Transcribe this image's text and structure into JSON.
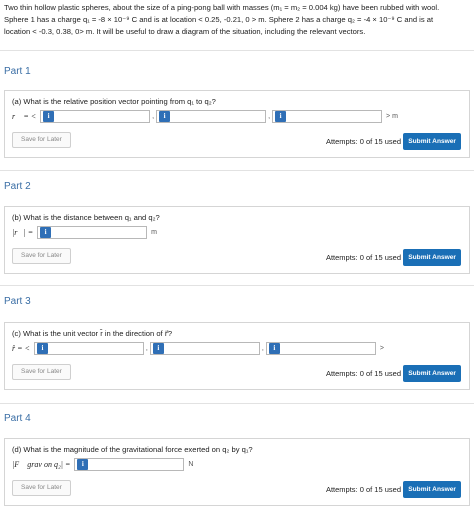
{
  "problem": {
    "line1": "Two thin hollow plastic spheres, about the size of a ping-pong ball with masses (m₁ = m₂ = 0.004 kg) have been rubbed with wool.",
    "line2": "Sphere 1 has a charge q₁ = -8 × 10⁻⁹ C and is at location < 0.25, -0.21, 0 > m. Sphere 2 has a charge q₂ = -4 × 10⁻⁹ C and is at",
    "line3": "location < -0.3, 0.38, 0> m. It will be useful to draw a diagram of the situation, including the relevant vectors."
  },
  "parts": [
    {
      "title": "Part 1",
      "question": "(a) What is the relative position vector pointing from q₁ to q₂?",
      "label": "r⃗ = <",
      "unit": "> m",
      "save": "Save for Later",
      "attempts": "Attempts: 0 of 15 used",
      "submit": "Submit Answer"
    },
    {
      "title": "Part 2",
      "question": "(b) What is the distance between q₁ and q₂?",
      "label": "|r⃗| =",
      "unit": "m",
      "save": "Save for Later",
      "attempts": "Attempts: 0 of 15 used",
      "submit": "Submit Answer"
    },
    {
      "title": "Part 3",
      "question": "(c) What is the unit vector r̂ in the direction of r⃗?",
      "label": "r̂ = <",
      "unit": ">",
      "save": "Save for Later",
      "attempts": "Attempts: 0 of 15 used",
      "submit": "Submit Answer"
    },
    {
      "title": "Part 4",
      "question": "(d) What is the magnitude of the gravitational force exerted on q₂ by q₁?",
      "label": "|F⃗ grav on q₂| =",
      "unit": "N",
      "save": "Save for Later",
      "attempts": "Attempts: 0 of 15 used",
      "submit": "Submit Answer"
    }
  ],
  "field_values": {
    "p1x": "",
    "p1y": "",
    "p1z": "",
    "p2": "",
    "p3x": "",
    "p3y": "",
    "p3z": "",
    "p4": ""
  },
  "icons": {
    "info": "info-icon"
  },
  "colors": {
    "accent": "#1a6fb6",
    "part_title": "#3a6ea5"
  }
}
